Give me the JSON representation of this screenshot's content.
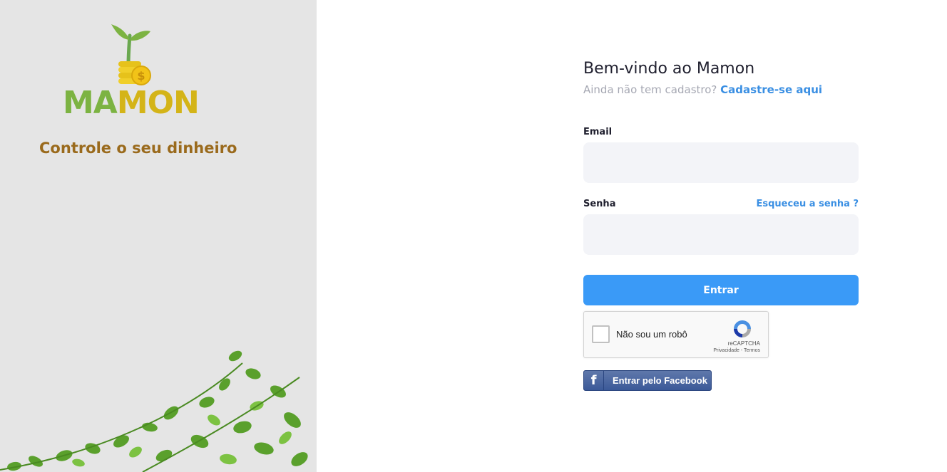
{
  "brand": {
    "logo_part1": "MA",
    "logo_part2": "MON",
    "tagline": "Controle o seu dinheiro",
    "colors": {
      "green": "#7cb342",
      "gold": "#d4b418",
      "tagline": "#9a6a1c",
      "panel": "#e5e5e5"
    }
  },
  "login": {
    "title": "Bem-vindo ao Mamon",
    "no_account_text": "Ainda não tem cadastro?",
    "signup_link": "Cadastre-se aqui",
    "email_label": "Email",
    "email_value": "",
    "password_label": "Senha",
    "password_value": "",
    "forgot_link": "Esqueceu a senha ?",
    "submit_label": "Entrar",
    "accent": "#3a9af7"
  },
  "captcha": {
    "label": "Não sou um robô",
    "brand": "reCAPTCHA",
    "terms": "Privacidade - Termos"
  },
  "facebook": {
    "icon_letter": "f",
    "label": "Entrar pelo Facebook"
  }
}
